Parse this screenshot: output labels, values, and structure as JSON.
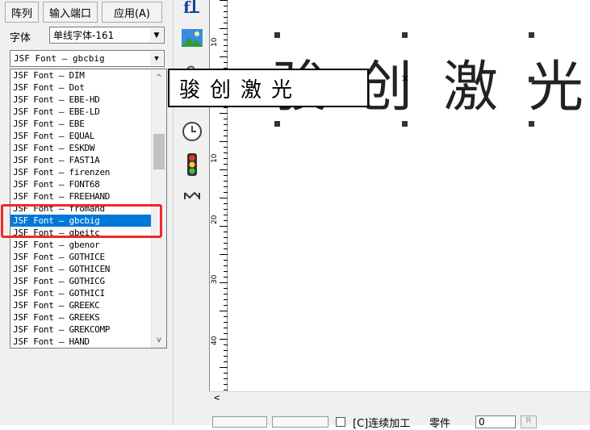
{
  "toolbar_buttons": {
    "array": "阵列",
    "input_port": "输入端口",
    "apply": "应用(A)"
  },
  "font_label": "字体",
  "font_type_combo": "单线字体-161",
  "font_name_combo": "JSF Font — gbcbig",
  "font_list": [
    "JSF Font — DIM",
    "JSF Font — Dot",
    "JSF Font — EBE-HD",
    "JSF Font — EBE-LD",
    "JSF Font — EBE",
    "JSF Font — EQUAL",
    "JSF Font — ESKDW",
    "JSF Font — FAST1A",
    "JSF Font — firenzen",
    "JSF Font — FONT68",
    "JSF Font — FREEHAND",
    "JSF Font — fromand",
    "JSF Font — gbcbig",
    "JSF Font — gbeitc",
    "JSF Font — gbenor",
    "JSF Font — GOTHICE",
    "JSF Font — GOTHICEN",
    "JSF Font — GOTHICG",
    "JSF Font — GOTHICI",
    "JSF Font — GREEKC",
    "JSF Font — GREEKS",
    "JSF Font — GREKCOMP",
    "JSF Font — HAND"
  ],
  "selected_index": 12,
  "edit_text": "骏创激光",
  "canvas_text": "骏创激光",
  "ruler_ticks": [
    "10",
    "0",
    "10",
    "20",
    "30",
    "40"
  ],
  "bottom_bar": {
    "continuous_label": "[C]连续加工",
    "parts_label": "零件",
    "parts_value": "0",
    "reset_label": "R"
  },
  "icons": [
    "text-tool-icon",
    "image-icon",
    "clock-icon",
    "traffic-light-icon",
    "signal-icon"
  ]
}
